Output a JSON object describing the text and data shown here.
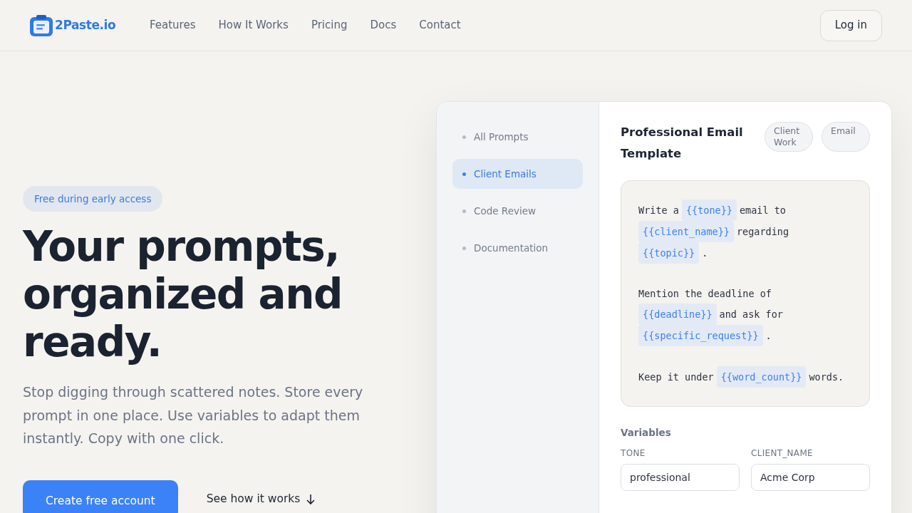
{
  "nav": {
    "brand": "2Paste.io",
    "links": [
      "Features",
      "How It Works",
      "Pricing",
      "Docs",
      "Contact"
    ],
    "login": "Log in"
  },
  "hero": {
    "badge": "Free during early access",
    "headline": [
      "Your prompts,",
      "organized and",
      "ready."
    ],
    "subtitle": "Stop digging through scattered notes. Store every prompt in one place. Use variables to adapt them instantly. Copy with one click.",
    "primary_button": "Create free account",
    "secondary_button": "See how it works"
  },
  "app": {
    "sidebar": [
      {
        "label": "All Prompts",
        "selected": false
      },
      {
        "label": "Client Emails",
        "selected": true
      },
      {
        "label": "Code Review",
        "selected": false
      },
      {
        "label": "Documentation",
        "selected": false
      }
    ],
    "title": "Professional Email Template",
    "tags": [
      "Client Work",
      "Email"
    ],
    "prompt": [
      [
        {
          "kind": "text",
          "text": "Write a"
        },
        {
          "kind": "var",
          "text": "{{tone}}"
        },
        {
          "kind": "text",
          "text": "email to"
        },
        {
          "kind": "var",
          "text": "{{client_name}}"
        },
        {
          "kind": "text",
          "text": "regarding"
        },
        {
          "kind": "var",
          "text": "{{topic}}"
        },
        {
          "kind": "text",
          "text": "."
        }
      ],
      [
        {
          "kind": "text",
          "text": "Mention the deadline of"
        },
        {
          "kind": "var",
          "text": "{{deadline}}"
        },
        {
          "kind": "text",
          "text": "and ask for"
        },
        {
          "kind": "var",
          "text": "{{specific_request}}"
        },
        {
          "kind": "text",
          "text": "."
        }
      ],
      [
        {
          "kind": "text",
          "text": "Keep it under"
        },
        {
          "kind": "var",
          "text": "{{word_count}}"
        },
        {
          "kind": "text",
          "text": "words."
        }
      ]
    ],
    "variables_heading": "Variables",
    "variables": [
      {
        "label": "TONE",
        "value": "professional"
      },
      {
        "label": "CLIENT_NAME",
        "value": "Acme Corp"
      }
    ]
  }
}
